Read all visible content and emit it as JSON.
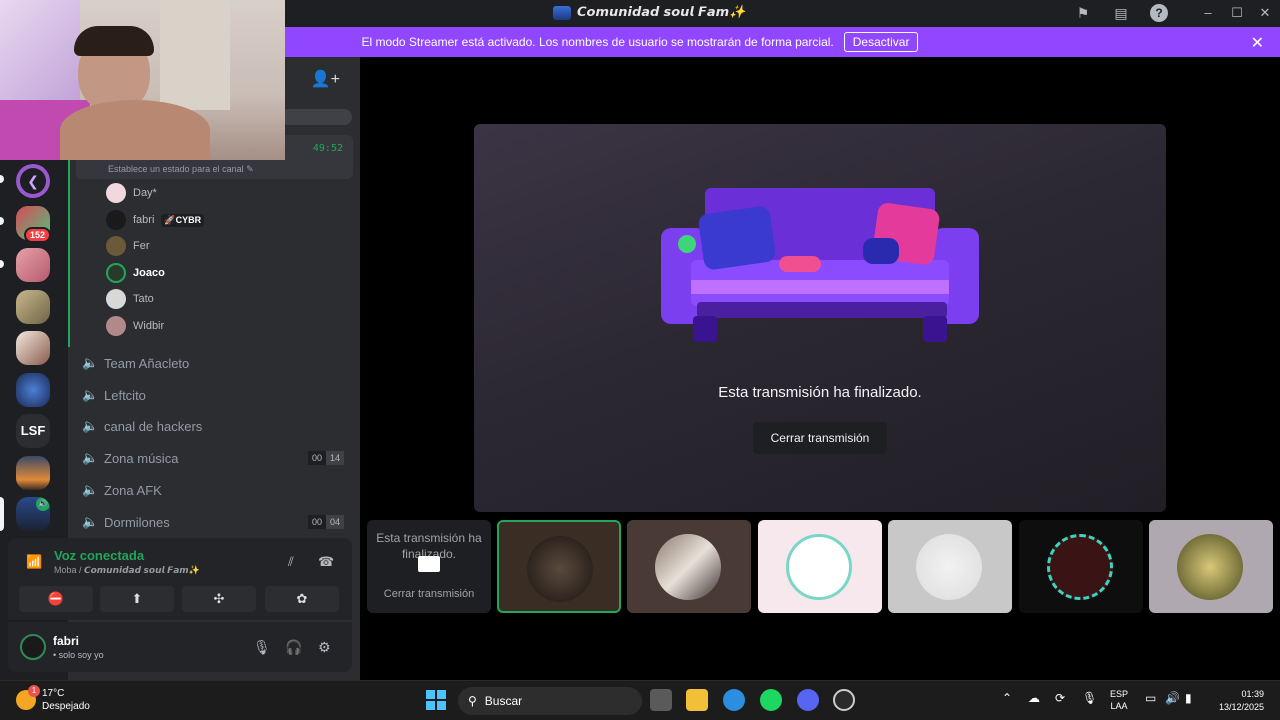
{
  "titlebar": {
    "title": "𝘾𝙤𝙢𝙪𝙣𝙞𝙙𝙖𝙙 𝙨𝙤𝙪𝙡 𝙁𝙖𝙢✨",
    "icons": [
      "flag-icon",
      "inbox-icon",
      "help-icon",
      "minimize-icon",
      "maximize-icon",
      "close-icon"
    ]
  },
  "banner": {
    "text": "El modo Streamer está activado. Los nombres de usuario se mostrarán de forma parcial.",
    "button": "Desactivar"
  },
  "guilds": {
    "badge": "152",
    "lsf_label": "LSF"
  },
  "channels": {
    "status_time": "49:52",
    "status_text": "Establece un estado para el canal ✎",
    "members": [
      {
        "name": "Day*"
      },
      {
        "name": "fabri",
        "tag": "🚀CYBR"
      },
      {
        "name": "Fer"
      },
      {
        "name": "Joaco"
      },
      {
        "name": "Tato"
      },
      {
        "name": "Widbir"
      }
    ],
    "voice_channels": [
      {
        "name": "Team Añacleto"
      },
      {
        "name": "Leftcito"
      },
      {
        "name": "canal de hackers"
      },
      {
        "name": "Zona música",
        "count_a": "00",
        "count_b": "14"
      },
      {
        "name": "Zona AFK"
      },
      {
        "name": "Dormilones",
        "count_a": "00",
        "count_b": "04"
      }
    ]
  },
  "voice": {
    "title": "Voz conectada",
    "subtitle": "Moba / 𝘾𝙤𝙢𝙪𝙣𝙞𝙙𝙖𝙙 𝙨𝙤𝙪𝙡 𝙁𝙖𝙢✨"
  },
  "user": {
    "name": "fabri",
    "status": "• solo soy yo"
  },
  "stage": {
    "message": "Esta transmisión ha finalizado.",
    "close_button": "Cerrar transmisión"
  },
  "mini_stream": {
    "message": "Esta transmisión ha finalizado.",
    "close_button": "Cerrar transmisión"
  },
  "taskbar": {
    "temp": "17°C",
    "weather": "Despejado",
    "weather_badge": "1",
    "search": "Buscar",
    "lang_top": "ESP",
    "lang_bottom": "LAA",
    "time": "01:39",
    "date": "13/12/2025"
  },
  "colors": {
    "accent_purple": "#9147ff",
    "voice_green": "#23a55a",
    "sidebar_bg": "#2b2d31",
    "guild_bg": "#1e1f22"
  }
}
